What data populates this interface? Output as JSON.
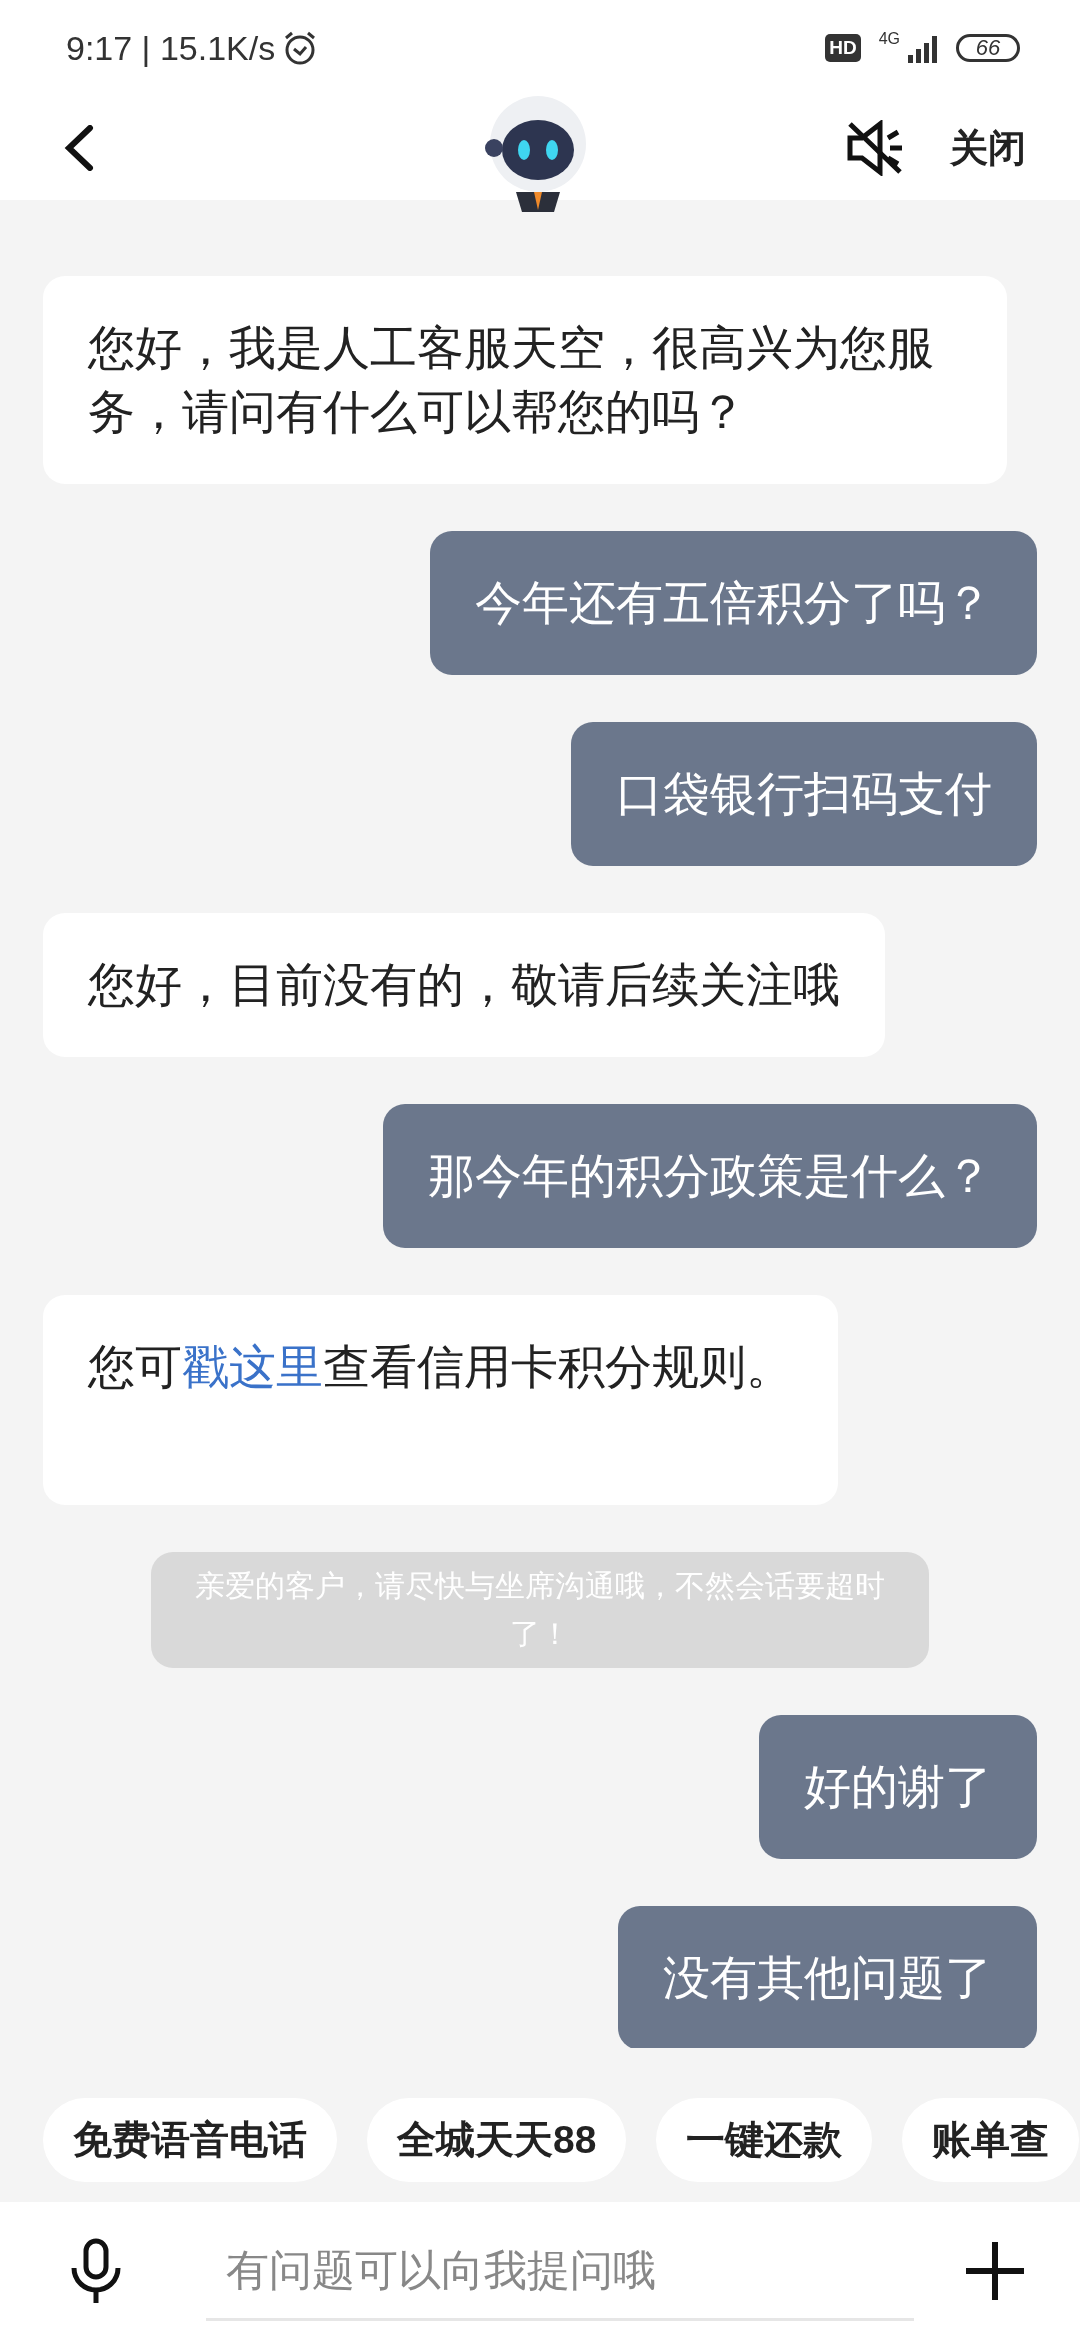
{
  "status_bar": {
    "time": "9:17 | 15.1K/s",
    "hd": "HD",
    "network": "4G",
    "battery": "66"
  },
  "header": {
    "close": "关闭"
  },
  "messages": [
    {
      "kind": "agent",
      "text": "您好，我是人工客服天空，很高兴为您服务，请问有什么可以帮您的吗？"
    },
    {
      "kind": "user",
      "text": "今年还有五倍积分了吗？"
    },
    {
      "kind": "user",
      "text": "口袋银行扫码支付"
    },
    {
      "kind": "agent",
      "text": "您好，目前没有的，敬请后续关注哦"
    },
    {
      "kind": "user",
      "text": "那今年的积分政策是什么？"
    },
    {
      "kind": "link",
      "before": "您可",
      "link": "戳这里",
      "after": "查看信用卡积分规则。"
    },
    {
      "kind": "notice",
      "text": "亲爱的客户，请尽快与坐席沟通哦，不然会话要超时了！"
    },
    {
      "kind": "user",
      "text": "好的谢了"
    },
    {
      "kind": "user",
      "text": "没有其他问题了"
    }
  ],
  "quick_replies": [
    "免费语音电话",
    "全城天天88",
    "一键还款",
    "账单查"
  ],
  "input": {
    "placeholder": "有问题可以向我提问哦"
  }
}
